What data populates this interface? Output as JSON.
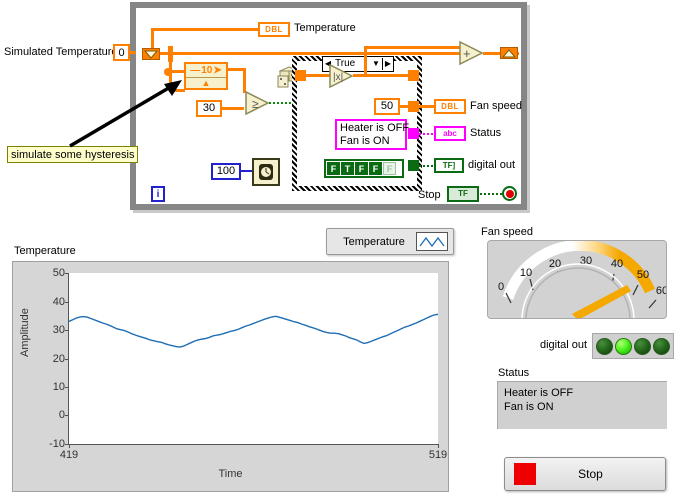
{
  "block_diagram": {
    "controls": {
      "simulated_temperature_label": "Simulated Temperature",
      "simulated_temperature_value": "0",
      "threshold_value": "30",
      "hysteresis_value": "10",
      "wait_ms_value": "100",
      "fan_speed_value": "50",
      "loop_index_label": "i"
    },
    "indicators": {
      "temperature_label": "Temperature",
      "temperature_type": "DBL",
      "fan_speed_label": "Fan speed",
      "fan_speed_type": "DBL",
      "status_label": "Status",
      "status_type": "abc",
      "digital_out_label": "digital out",
      "digital_out_type": "TF]",
      "stop_label": "Stop",
      "stop_type": "TF"
    },
    "case_structure": {
      "selector": "True"
    },
    "string_constant": "Heater is OFF\nFan is ON",
    "boolean_array": [
      "F",
      "T",
      "F",
      "F",
      "F"
    ],
    "comment": "simulate some hysteresis",
    "icons": {
      "random": "dice-icon",
      "wait": "wait-timer-icon",
      "greater": "greater-than-icon",
      "absolute": "absolute-value-icon",
      "add": "add-icon",
      "shift_in": "shift-register-left-icon",
      "shift_out": "shift-register-right-icon",
      "case_question": "case-selector-icon"
    }
  },
  "front_panel": {
    "chart": {
      "title": "Temperature",
      "legend_series": "Temperature"
    },
    "gauge": {
      "label": "Fan speed"
    },
    "digital_out": {
      "label": "digital out",
      "leds": [
        "off",
        "on",
        "off",
        "off"
      ]
    },
    "status": {
      "label": "Status",
      "text": "Heater is OFF\nFan is ON"
    },
    "stop": {
      "label": "Stop"
    }
  },
  "chart_data": {
    "type": "line",
    "title": "Temperature",
    "xlabel": "Time",
    "ylabel": "Amplitude",
    "ylim": [
      -10,
      50
    ],
    "yticks": [
      50,
      40,
      30,
      20,
      10,
      0,
      -10
    ],
    "xlim": [
      419,
      519
    ],
    "xticks": [
      419,
      519
    ],
    "grid": false,
    "legend_position": "top-right",
    "series": [
      {
        "name": "Temperature",
        "color": "#1f6eb5",
        "x": [
          419,
          420,
          421,
          422,
          423,
          424,
          425,
          426,
          427,
          428,
          429,
          430,
          431,
          432,
          433,
          434,
          435,
          436,
          437,
          438,
          439,
          440,
          441,
          442,
          443,
          444,
          445,
          446,
          447,
          448,
          449,
          450,
          451,
          452,
          453,
          454,
          455,
          456,
          457,
          458,
          459,
          460,
          461,
          462,
          463,
          464,
          465,
          466,
          467,
          468,
          469,
          470,
          471,
          472,
          473,
          474,
          475,
          476,
          477,
          478,
          479,
          480,
          481,
          482,
          483,
          484,
          485,
          486,
          487,
          488,
          489,
          490,
          491,
          492,
          493,
          494,
          495,
          496,
          497,
          498,
          499,
          500,
          501,
          502,
          503,
          504,
          505,
          506,
          507,
          508,
          509,
          510,
          511,
          512,
          513,
          514,
          515,
          516,
          517,
          518,
          519
        ],
        "values": [
          33.0,
          33.6,
          34.2,
          34.6,
          34.7,
          34.5,
          34.0,
          33.5,
          33.0,
          32.5,
          32.1,
          31.6,
          31.0,
          30.4,
          30.1,
          29.8,
          29.3,
          28.7,
          28.2,
          27.8,
          27.4,
          27.0,
          26.5,
          26.2,
          25.9,
          25.7,
          25.2,
          24.8,
          24.5,
          24.2,
          24.0,
          24.3,
          24.9,
          25.5,
          26.1,
          26.5,
          26.8,
          27.0,
          27.4,
          27.9,
          28.2,
          28.4,
          28.8,
          29.2,
          29.6,
          29.9,
          30.3,
          30.9,
          31.4,
          31.8,
          32.3,
          32.8,
          33.3,
          33.8,
          34.2,
          34.6,
          34.8,
          34.5,
          34.1,
          33.7,
          33.3,
          32.9,
          32.6,
          32.1,
          31.7,
          31.2,
          30.8,
          30.4,
          29.9,
          29.4,
          29.1,
          28.9,
          28.9,
          28.7,
          28.3,
          27.9,
          27.3,
          26.9,
          26.5,
          25.8,
          25.3,
          25.6,
          26.1,
          26.6,
          27.1,
          27.6,
          28.0,
          28.6,
          29.2,
          29.8,
          30.4,
          31.0,
          31.4,
          31.9,
          32.4,
          33.0,
          33.6,
          34.2,
          34.8,
          35.3,
          35.5,
          33.0
        ]
      }
    ]
  }
}
